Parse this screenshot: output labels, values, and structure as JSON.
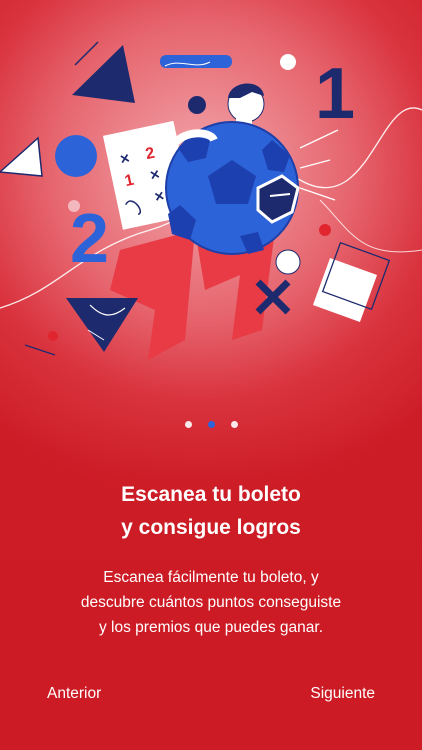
{
  "onboarding": {
    "illustration_icon": "soccer-ball-scan-illustration",
    "pagination": {
      "total": 3,
      "active_index": 1
    },
    "title_lines": [
      "Escanea tu boleto",
      "y consigue logros"
    ],
    "body_lines": [
      "Escanea fácilmente tu boleto, y",
      "descubre cuántos puntos conseguiste",
      "y los premios que puedes ganar."
    ],
    "ticket_marks": [
      "×",
      "2",
      "1",
      "×",
      "×",
      "×"
    ],
    "big_numbers": [
      "1",
      "2"
    ],
    "prev_label": "Anterior",
    "next_label": "Siguiente"
  },
  "colors": {
    "background_red": "#cc1c26",
    "accent_blue": "#2d63d8",
    "navy": "#1e2a6e",
    "white": "#ffffff"
  }
}
